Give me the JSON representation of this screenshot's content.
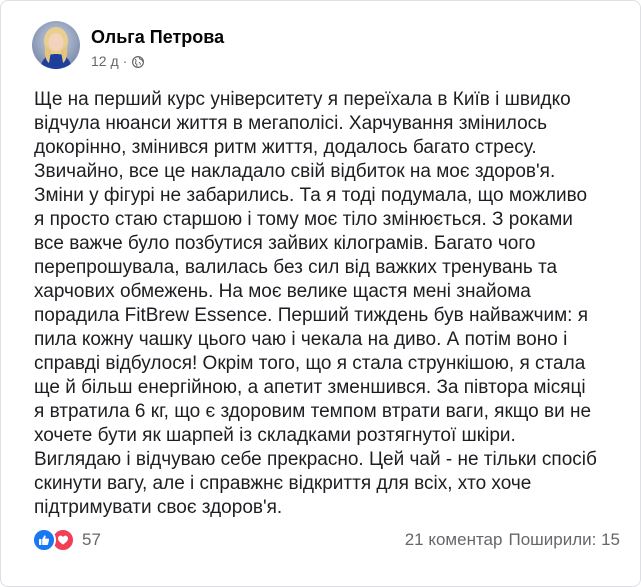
{
  "post": {
    "author": "Ольга Петрова",
    "time": "12 д",
    "separator": "·",
    "privacy_icon": "globe-icon",
    "text": "Ще на перший курс університету я переїхала в Київ і швидко\nвідчула нюанси життя в мегаполісі. Харчування змінилось\nдокорінно, змінився ритм життя, додалось багато стресу.\nЗвичайно, все це накладало свій відбиток на моє здоров'я.\nЗміни у фігурі не забарились. Та я тоді подумала, що можливо\nя просто стаю старшою і тому моє тіло змінюється. З роками\nвсе  важче було позбутися зайвих кілограмів. Багато чого\nперепрошувала, валилась без сил від важких тренувань та\nхарчових обмежень. На моє велике щастя мені знайома\nпорадила FitBrew Essence. Перший тиждень був найважчим: я\nпила кожну чашку цього чаю і чекала на диво. А потім воно і\nсправді відбулося! Окрім того, що я стала стрункішою, я стала\nще й більш енергійною, а апетит зменшився. За півтора місяці\nя втратила 6 кг, що є здоровим темпом втрати ваги, якщо ви не\nхочете бути як шарпей із складками розтягнутої шкіри.\nВиглядаю і відчуваю себе прекрасно. Цей чай - не тільки спосіб\nскинути вагу, але і справжнє відкриття для всіх, хто хоче\nпідтримувати своє здоров'я."
  },
  "footer": {
    "reactions_count": "57",
    "reaction_icons": [
      "like-icon",
      "love-icon"
    ],
    "comments": "21 коментар",
    "shares": "Поширили: 15"
  },
  "colors": {
    "like": "#1877f2",
    "love": "#f33e58",
    "secondary_text": "#65676b",
    "primary_text": "#050505"
  }
}
